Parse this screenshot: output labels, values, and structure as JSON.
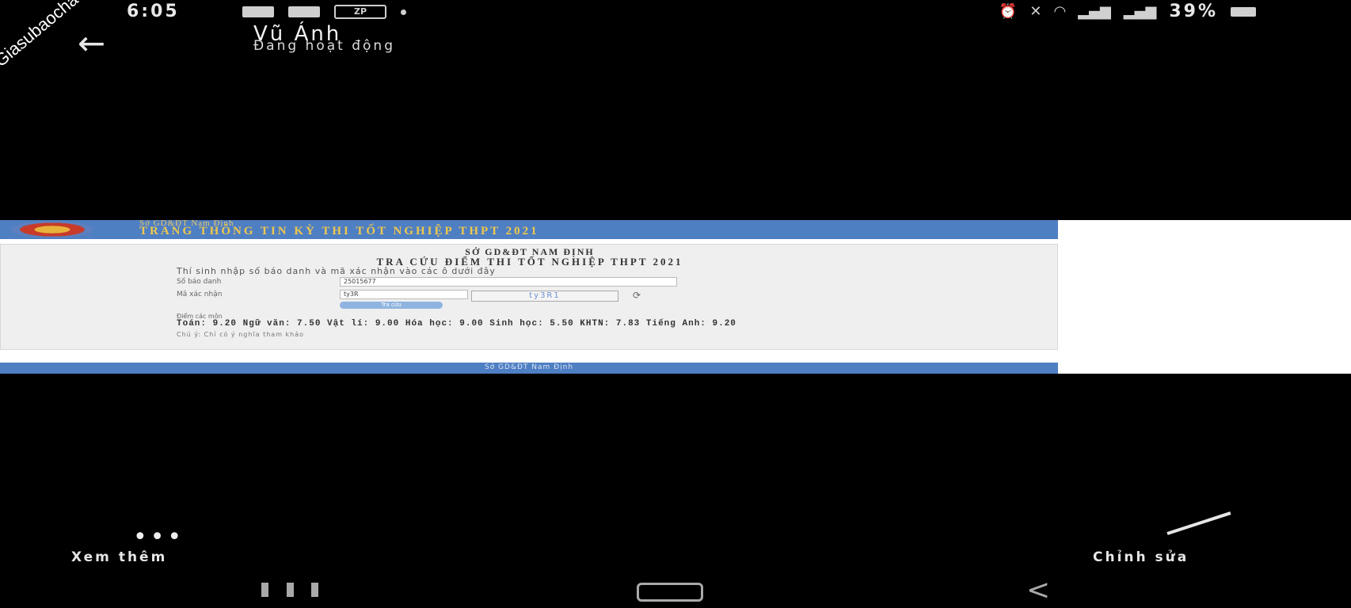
{
  "status_bar": {
    "time": "6:05",
    "zp_label": "ZP",
    "battery": "39%"
  },
  "header": {
    "back_icon": "arrow-left-icon",
    "contact_name": "Vũ Ánh",
    "contact_status": "Đang hoạt động"
  },
  "watermark": "Giasubaochau.net",
  "screenshot": {
    "banner_line1": "Sở GD&ĐT Nam Định",
    "banner_line2": "TRANG THÔNG TIN KỲ THI TỐT NGHIỆP THPT 2021",
    "title1": "SỞ GD&ĐT NAM ĐỊNH",
    "title2": "TRA CỨU ĐIỂM THI TỐT NGHIỆP THPT 2021",
    "instruction": "Thí sinh nhập số báo danh và mã xác nhận vào các ô dưới đây",
    "sbd_label": "Số báo danh",
    "sbd_value": "25015677",
    "captcha_label": "Mã xác nhận",
    "captcha_input": "ty3R",
    "captcha_text": "ty3R1",
    "button_label": "Tra cứu",
    "result_label": "Điểm các môn",
    "scores": "Toán:  9.20  Ngữ văn:  7.50  Vật lí:  9.00  Hóa học:  9.00  Sinh học:  5.50  KHTN: 7.83  Tiếng Anh:  9.20",
    "note": "Chú ý: Chỉ có ý nghĩa tham khảo",
    "footer": "Sở GD&ĐT Nam Định"
  },
  "actions": {
    "more_label": "Xem thêm",
    "edit_label": "Chỉnh sửa"
  }
}
